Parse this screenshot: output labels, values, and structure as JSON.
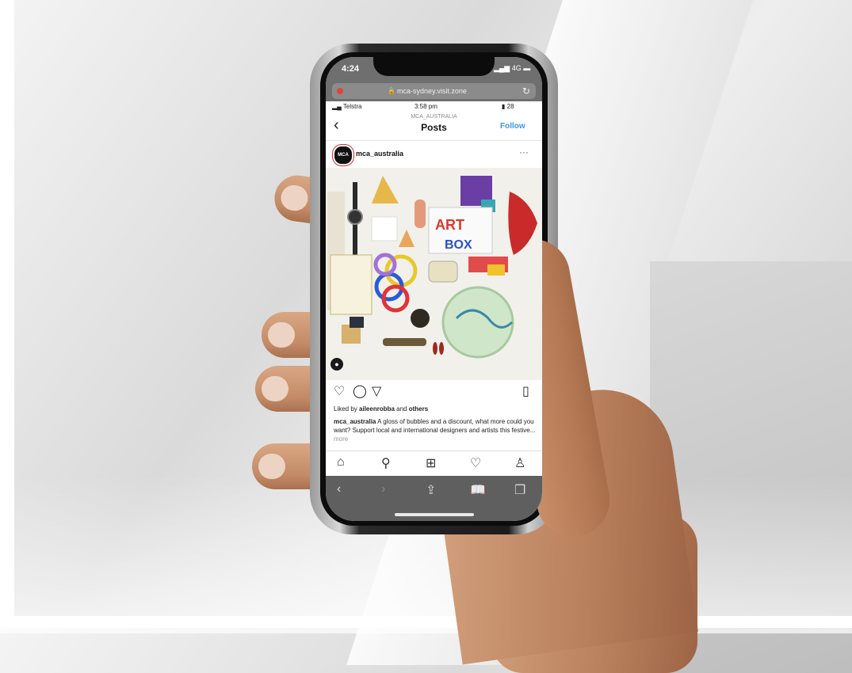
{
  "phone_status": {
    "time": "4:24",
    "signal": "4G"
  },
  "browser": {
    "url": "mca-sydney.visit.zone",
    "lock_icon": "lock-icon",
    "reload_icon": "reload-icon"
  },
  "instagram_status": {
    "carrier": "Telstra",
    "time": "3:58 pm",
    "battery": "28"
  },
  "instagram_header": {
    "back_icon": "chevron-left-icon",
    "account": "MCA_AUSTRALIA",
    "title": "Posts",
    "follow_label": "Follow"
  },
  "post": {
    "avatar_text": "MCA",
    "username": "mca_australia",
    "more_label": "···",
    "liked_prefix": "Liked by ",
    "liked_user": "aileenrobba",
    "liked_suffix": " and ",
    "liked_others": "others",
    "caption_user": "mca_australia",
    "caption_text": " A gloss of bubbles and a discount, what more could you want? Support local and international designers and artists this festive...",
    "caption_more": " more",
    "image_sign_text": "ART IN THE BOX",
    "tag_icon": "user-tag-icon"
  },
  "post_actions": [
    "heart-icon",
    "comment-icon",
    "send-icon",
    "bookmark-icon"
  ],
  "instagram_tabs": [
    "home-icon",
    "search-icon",
    "add-post-icon",
    "activity-icon",
    "profile-icon"
  ],
  "safari_toolbar": [
    "back-icon",
    "forward-icon",
    "share-icon",
    "bookmarks-icon",
    "tabs-icon"
  ]
}
